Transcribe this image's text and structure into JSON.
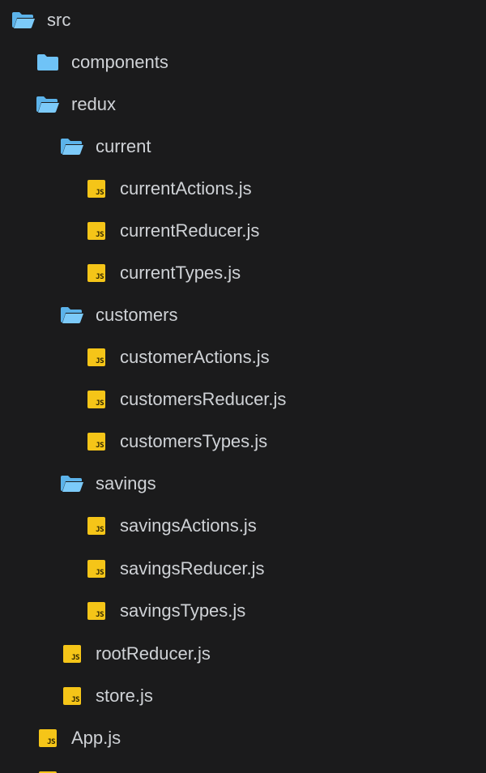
{
  "tree": {
    "items": [
      {
        "label": "src",
        "kind": "folder-open"
      },
      {
        "label": "components",
        "kind": "folder-closed"
      },
      {
        "label": "redux",
        "kind": "folder-open"
      },
      {
        "label": "current",
        "kind": "folder-open"
      },
      {
        "label": "currentActions.js",
        "kind": "js-file"
      },
      {
        "label": "currentReducer.js",
        "kind": "js-file"
      },
      {
        "label": "currentTypes.js",
        "kind": "js-file"
      },
      {
        "label": "customers",
        "kind": "folder-open"
      },
      {
        "label": "customerActions.js",
        "kind": "js-file"
      },
      {
        "label": "customersReducer.js",
        "kind": "js-file"
      },
      {
        "label": "customersTypes.js",
        "kind": "js-file"
      },
      {
        "label": "savings",
        "kind": "folder-open"
      },
      {
        "label": "savingsActions.js",
        "kind": "js-file"
      },
      {
        "label": "savingsReducer.js",
        "kind": "js-file"
      },
      {
        "label": "savingsTypes.js",
        "kind": "js-file"
      },
      {
        "label": "rootReducer.js",
        "kind": "js-file"
      },
      {
        "label": "store.js",
        "kind": "js-file"
      },
      {
        "label": "App.js",
        "kind": "js-file"
      }
    ],
    "js_badge_text": "JS"
  },
  "colors": {
    "background": "#1b1b1c",
    "text": "#cfd2d6",
    "folder": "#6fc3f7",
    "js_badge": "#f5c518"
  }
}
